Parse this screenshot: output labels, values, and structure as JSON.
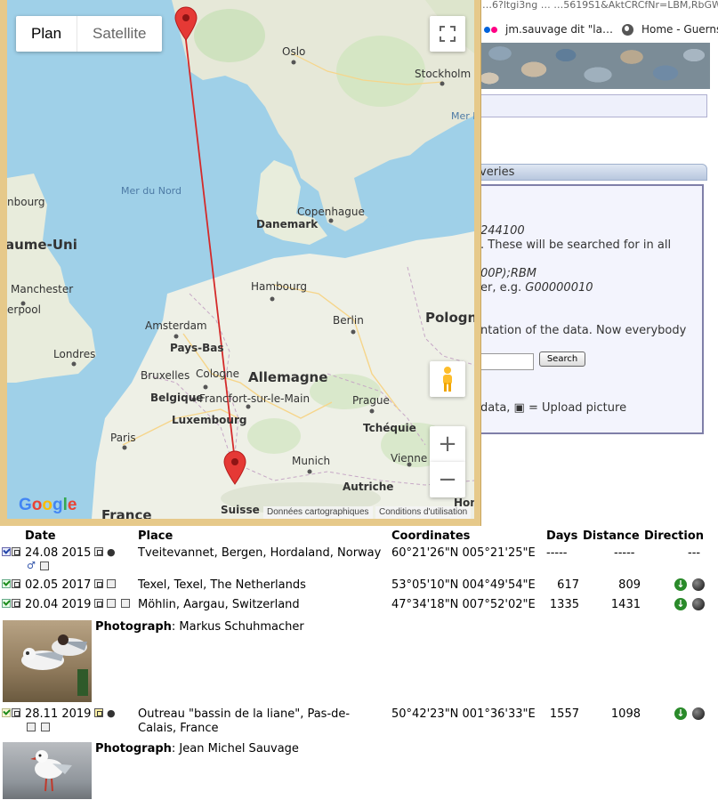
{
  "background_page": {
    "url_text": "…6?ltgi3ng  …  …5619S1&AktCRCfNr=LBM,RbGW(J4J5)&Akt",
    "bookmarks": [
      {
        "label": "jm.sauvage dit \"la…",
        "icon": "flickr-icon"
      },
      {
        "label": "Home - Guernse",
        "icon": "globe-icon"
      }
    ],
    "queries_tab": "veries",
    "info_lines": [
      {
        "text": "244100",
        "italic": true
      },
      {
        "text": ". These will be searched for in all",
        "italic": false
      },
      {
        "text": "00P);RBM",
        "italic": true
      },
      {
        "text": "er, e.g. ",
        "italic": false,
        "suffix": "G00000010"
      },
      {
        "text": "ntation of the data. Now everybody",
        "italic": false
      },
      {
        "text": "data, ▣ = Upload picture",
        "italic": false
      }
    ],
    "search_button": "Search"
  },
  "map": {
    "type_plan": "Plan",
    "type_satellite": "Satellite",
    "google": [
      "G",
      "o",
      "o",
      "g",
      "l",
      "e"
    ],
    "attribution_data": "Données cartographiques",
    "attribution_terms": "Conditions d'utilisation",
    "labels": {
      "oslo": "Oslo",
      "stockholm": "Stockholm",
      "mer_b": "Mer B",
      "mer_du_nord": "Mer du Nord",
      "nbourg": "nbourg",
      "aume_uni": "aume-Uni",
      "danemark": "Danemark",
      "copenhague": "Copenhague",
      "manchester": "Manchester",
      "erpool": "erpool",
      "hambourg": "Hambourg",
      "berlin": "Berlin",
      "pologne": "Pologn",
      "amsterdam": "Amsterdam",
      "pays_bas": "Pays-Bas",
      "londres": "Londres",
      "bruxelles": "Bruxelles",
      "cologne": "Cologne",
      "allemagne": "Allemagne",
      "belgique": "Belgique",
      "francfort": "Francfort-sur-le-Main",
      "prague": "Prague",
      "luxembourg": "Luxembourg",
      "tcheque": "Tchéquie",
      "paris": "Paris",
      "munich": "Munich",
      "vienne": "Vienne",
      "autriche": "Autriche",
      "france": "France",
      "suisse": "Suisse",
      "hon": "Hon"
    }
  },
  "table": {
    "headers": {
      "date": "Date",
      "place": "Place",
      "coordinates": "Coordinates",
      "days": "Days",
      "distance": "Distance",
      "direction": "Direction"
    },
    "rows": [
      {
        "date": "24.08 2015",
        "place": "Tveitevannet, Bergen, Hordaland, Norway",
        "coords": "60°21'26\"N 005°21'25\"E",
        "days": "-----",
        "distance": "-----",
        "direction": "---",
        "extra_icons": "♂"
      },
      {
        "date": "02.05 2017",
        "place": "Texel, Texel, The Netherlands",
        "coords": "53°05'10\"N 004°49'54\"E",
        "days": "617",
        "distance": "809",
        "direction": ""
      },
      {
        "date": "20.04 2019",
        "place": "Möhlin, Aargau, Switzerland",
        "coords": "47°34'18\"N 007°52'02\"E",
        "days": "1335",
        "distance": "1431",
        "direction": ""
      },
      {
        "date": "28.11 2019",
        "place_line1": "Outreau \"bassin de la liane\", Pas-de-",
        "place_line2": "Calais, France",
        "coords": "50°42'23\"N 001°36'33\"E",
        "days": "1557",
        "distance": "1098",
        "direction": ""
      }
    ],
    "photos": [
      {
        "label": "Photograph",
        "author": ": Markus Schuhmacher"
      },
      {
        "label": "Photograph",
        "author": ": Jean Michel Sauvage"
      }
    ]
  }
}
